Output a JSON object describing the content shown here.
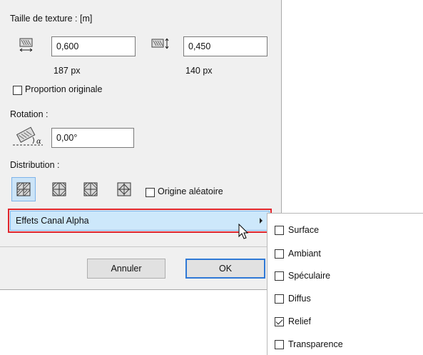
{
  "texture_size": {
    "title": "Taille de texture : [m]",
    "width_value": "0,600",
    "height_value": "0,450",
    "width_px": "187 px",
    "height_px": "140 px",
    "width_icon": "texture-width-icon",
    "height_icon": "texture-height-icon"
  },
  "proportion": {
    "label": "Proportion originale",
    "checked": false
  },
  "rotation": {
    "title": "Rotation :",
    "value": "0,00°",
    "icon": "rotation-angle-icon"
  },
  "distribution": {
    "title": "Distribution :",
    "buttons": [
      "distribution-pattern-1-icon",
      "distribution-pattern-2-icon",
      "distribution-pattern-3-icon",
      "distribution-pattern-4-icon"
    ],
    "selected_index": 0,
    "random_origin_label": "Origine aléatoire",
    "random_origin_checked": false
  },
  "alpha_channel": {
    "label": "Effets Canal Alpha",
    "highlight_color": "#e0262d"
  },
  "buttons": {
    "cancel": "Annuler",
    "ok": "OK"
  },
  "submenu": {
    "items": [
      {
        "label": "Surface",
        "checked": false
      },
      {
        "label": "Ambiant",
        "checked": false
      },
      {
        "label": "Spéculaire",
        "checked": false
      },
      {
        "label": "Diffus",
        "checked": false
      },
      {
        "label": "Relief",
        "checked": true
      },
      {
        "label": "Transparence",
        "checked": false
      }
    ]
  },
  "colors": {
    "accent": "#2f79d6",
    "selection": "#cde8fb"
  }
}
